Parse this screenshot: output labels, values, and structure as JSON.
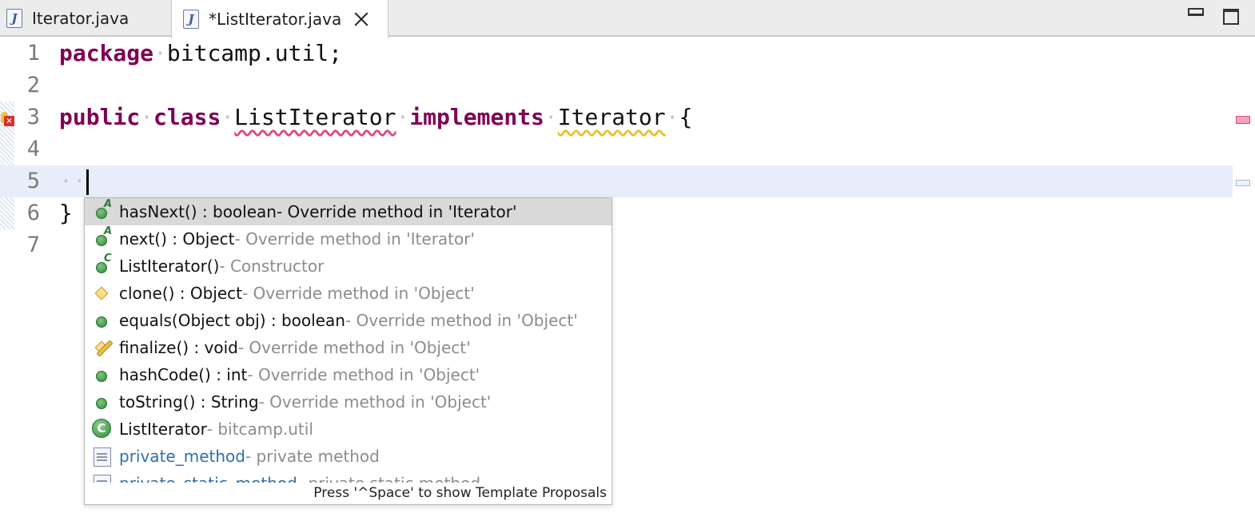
{
  "tabs": [
    {
      "label": "Iterator.java",
      "active": false
    },
    {
      "label": "*ListIterator.java",
      "active": true
    }
  ],
  "window_controls": {
    "minimize_icon": "minimize-icon",
    "maximize_icon": "maximize-icon"
  },
  "editor": {
    "line_numbers": [
      "1",
      "2",
      "3",
      "4",
      "5",
      "6",
      "7"
    ],
    "lines": {
      "l1_kw": "package",
      "l1_rest": "bitcamp.util;",
      "l3_kw1": "public",
      "l3_kw2": "class",
      "l3_name": "ListIterator",
      "l3_kw3": "implements",
      "l3_iface": "Iterator",
      "l3_brace": "{",
      "l5_ws": "··",
      "l6_brace": "}"
    },
    "colors": {
      "keyword": "#7f0055",
      "current_line": "#e8eef9",
      "error_underline": "#e0457b",
      "warning_underline": "#e8c02a"
    }
  },
  "content_assist": {
    "proposals": [
      {
        "name": "hasNext() : boolean",
        "desc": " - Override method in 'Iterator'",
        "icon": "abstract-method-icon",
        "selected": true
      },
      {
        "name": "next() : Object",
        "desc": " - Override method in 'Iterator'",
        "icon": "abstract-method-icon"
      },
      {
        "name": "ListIterator()",
        "desc": " - Constructor",
        "icon": "constructor-icon"
      },
      {
        "name": "clone() : Object",
        "desc": " - Override method in 'Object'",
        "icon": "protected-method-icon"
      },
      {
        "name": "equals(Object obj) : boolean",
        "desc": " - Override method in 'Object'",
        "icon": "public-method-icon"
      },
      {
        "name": "finalize() : void",
        "desc": " - Override method in 'Object'",
        "icon": "deprecated-method-icon"
      },
      {
        "name": "hashCode() : int",
        "desc": " - Override method in 'Object'",
        "icon": "public-method-icon"
      },
      {
        "name": "toString() : String",
        "desc": " - Override method in 'Object'",
        "icon": "public-method-icon"
      },
      {
        "name": "ListIterator",
        "desc": " - bitcamp.util",
        "icon": "class-icon"
      },
      {
        "name": "private_method",
        "desc": " - private method",
        "icon": "template-icon"
      },
      {
        "name": "private_static_method",
        "desc": " - private static method",
        "icon": "template-icon"
      }
    ],
    "footer": "Press '^Space' to show Template Proposals"
  }
}
